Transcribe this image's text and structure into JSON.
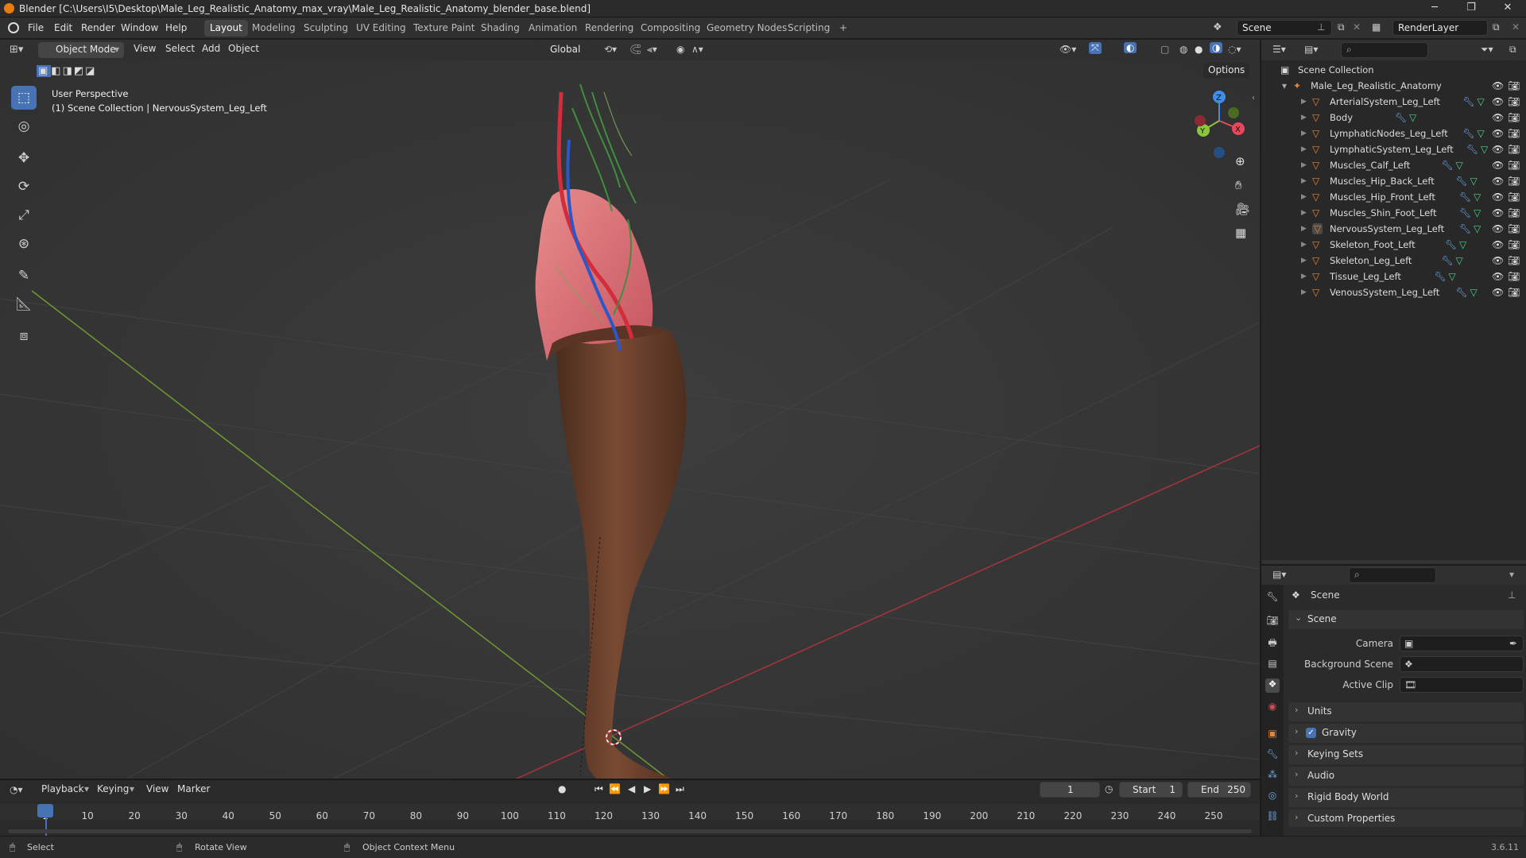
{
  "titlebar": {
    "title": "Blender [C:\\Users\\I5\\Desktop\\Male_Leg_Realistic_Anatomy_max_vray\\Male_Leg_Realistic_Anatomy_blender_base.blend]",
    "minimize": "─",
    "maximize": "❐",
    "close": "✕"
  },
  "menu": [
    "File",
    "Edit",
    "Render",
    "Window",
    "Help"
  ],
  "workspaces": [
    "Layout",
    "Modeling",
    "Sculpting",
    "UV Editing",
    "Texture Paint",
    "Shading",
    "Animation",
    "Rendering",
    "Compositing",
    "Geometry Nodes",
    "Scripting",
    "+"
  ],
  "scene_name": "Scene",
  "render_layer": "RenderLayer",
  "viewport_header": {
    "mode": "Object Mode",
    "menus": [
      "View",
      "Select",
      "Add",
      "Object"
    ],
    "transform_orientation": "Global",
    "options": "Options"
  },
  "viewport": {
    "view_name": "User Perspective",
    "collection_info": "(1) Scene Collection | NervousSystem_Leg_Left",
    "gizmo": {
      "x": "X",
      "y": "Y",
      "z": "Z"
    }
  },
  "outliner": {
    "root": "Scene Collection",
    "collection": "Male_Leg_Realistic_Anatomy",
    "objects": [
      "ArterialSystem_Leg_Left",
      "Body",
      "LymphaticNodes_Leg_Left",
      "LymphaticSystem_Leg_Left",
      "Muscles_Calf_Left",
      "Muscles_Hip_Back_Left",
      "Muscles_Hip_Front_Left",
      "Muscles_Shin_Foot_Left",
      "NervousSystem_Leg_Left",
      "Skeleton_Foot_Left",
      "Skeleton_Leg_Left",
      "Tissue_Leg_Left",
      "VenousSystem_Leg_Left"
    ],
    "active_object": "NervousSystem_Leg_Left"
  },
  "properties": {
    "context": "Scene",
    "panel_scene": "Scene",
    "camera_label": "Camera",
    "background_scene_label": "Background Scene",
    "active_clip_label": "Active Clip",
    "sections": [
      "Units",
      "Gravity",
      "Keying Sets",
      "Audio",
      "Rigid Body World",
      "Custom Properties"
    ],
    "gravity_enabled": true
  },
  "timeline": {
    "menus": [
      "Playback",
      "Keying",
      "View",
      "Marker"
    ],
    "current_frame": "1",
    "start_label": "Start",
    "start": "1",
    "end_label": "End",
    "end": "250",
    "ticks": [
      "1",
      "10",
      "20",
      "30",
      "40",
      "50",
      "60",
      "70",
      "80",
      "90",
      "100",
      "110",
      "120",
      "130",
      "140",
      "150",
      "160",
      "170",
      "180",
      "190",
      "200",
      "210",
      "220",
      "230",
      "240",
      "250"
    ]
  },
  "statusbar": {
    "select": "Select",
    "rotate": "Rotate View",
    "context_menu": "Object Context Menu",
    "version": "3.6.11"
  },
  "colors": {
    "accent": "#4772b3",
    "object_icon": "#e3873a",
    "modifier_icon": "#6fa8e6",
    "mesh_icon": "#4fd18b",
    "axis_x": "#e8485b",
    "axis_y": "#8cc63f",
    "axis_z": "#3f8fe8"
  }
}
